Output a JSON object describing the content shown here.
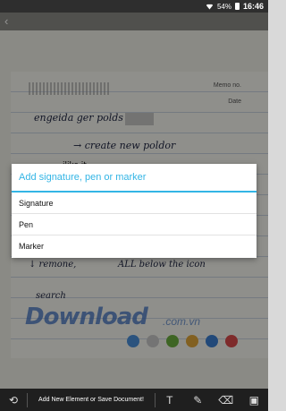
{
  "status_bar": {
    "battery_percent": "54%",
    "time": "16:46",
    "wifi_icon": "wifi-icon",
    "battery_icon": "battery-icon"
  },
  "document": {
    "meta_1": "Memo no.",
    "meta_2": "Date",
    "handwriting_1": "engeida ger polds",
    "handwriting_2": "→ create new poldor",
    "note": "ilike it",
    "handwriting_3": "↓ remone,",
    "handwriting_4": "ALL below the icon",
    "handwriting_5": "search",
    "watermark": "Download",
    "watermark_suffix": ".com.vn",
    "palette_colors": [
      "#4a90d9",
      "#c9c9c9",
      "#6cae3f",
      "#e0a53a",
      "#3b7fd1",
      "#d94b4b"
    ]
  },
  "dialog": {
    "title": "Add signature, pen or marker",
    "items": [
      {
        "label": "Signature"
      },
      {
        "label": "Pen"
      },
      {
        "label": "Marker"
      }
    ],
    "accent_color": "#33b5e5"
  },
  "toolbar": {
    "undo_icon": "undo-icon",
    "label": "Add New Element or Save Document!",
    "text_icon": "T",
    "edit_icon": "edit-icon",
    "eraser_icon": "eraser-icon",
    "save_icon": "save-icon"
  }
}
